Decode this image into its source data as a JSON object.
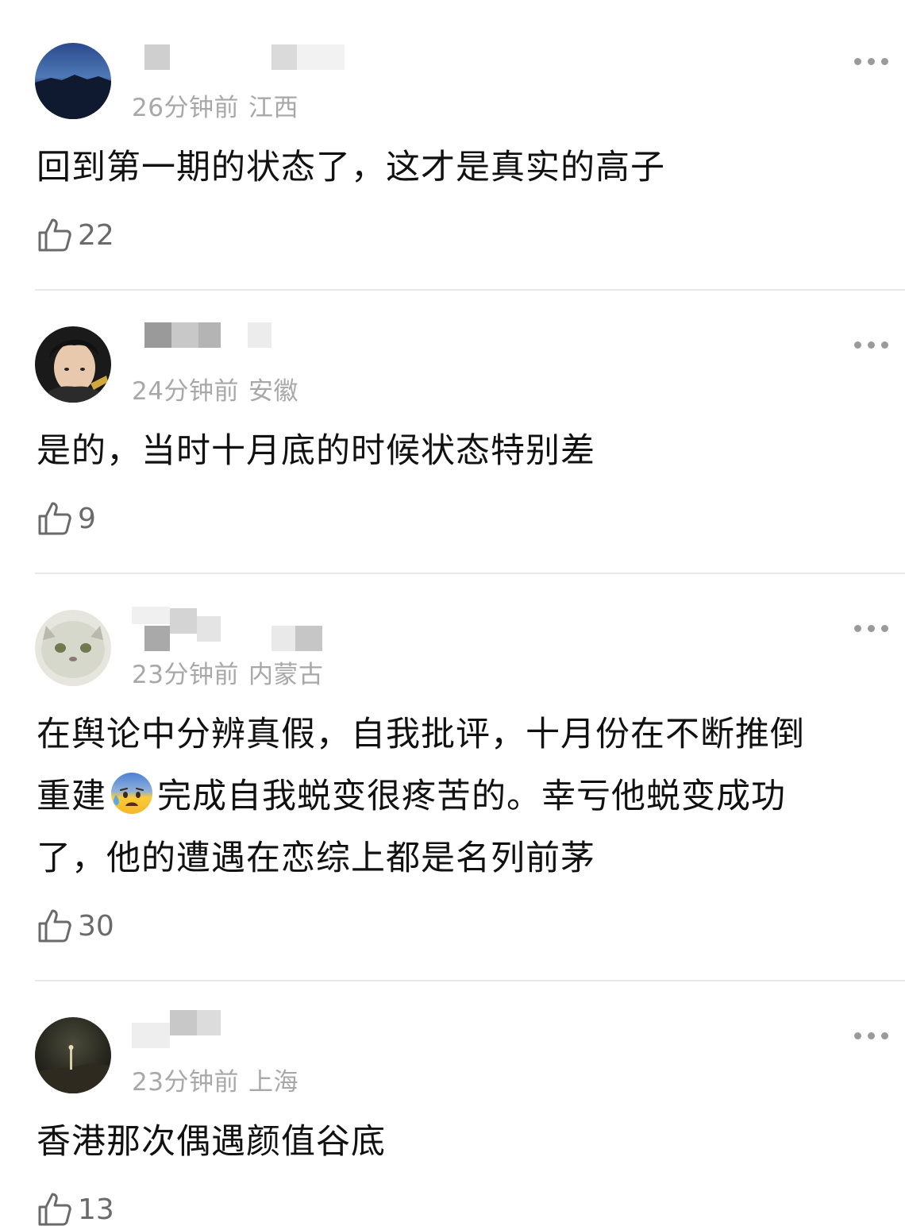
{
  "comments": [
    {
      "time": "26分钟前",
      "location": "江西",
      "text": "回到第一期的状态了，这才是真实的高子",
      "likes": "22"
    },
    {
      "time": "24分钟前",
      "location": "安徽",
      "text": "是的，当时十月底的时候状态特别差",
      "likes": "9"
    },
    {
      "time": "23分钟前",
      "location": "内蒙古",
      "text_line1": "在舆论中分辨真假，自我批评，十月份在不断推倒",
      "text_line2a": "重建",
      "text_line2b": "完成自我蜕变很疼苦的。幸亏他蜕变成功",
      "text_line3": "了，他的遭遇在恋综上都是名列前茅",
      "emoji": "anxious-face-with-sweat-emoji",
      "likes": "30"
    },
    {
      "time": "23分钟前",
      "location": "上海",
      "text": "香港那次偶遇颜值谷底",
      "likes": "13"
    }
  ]
}
